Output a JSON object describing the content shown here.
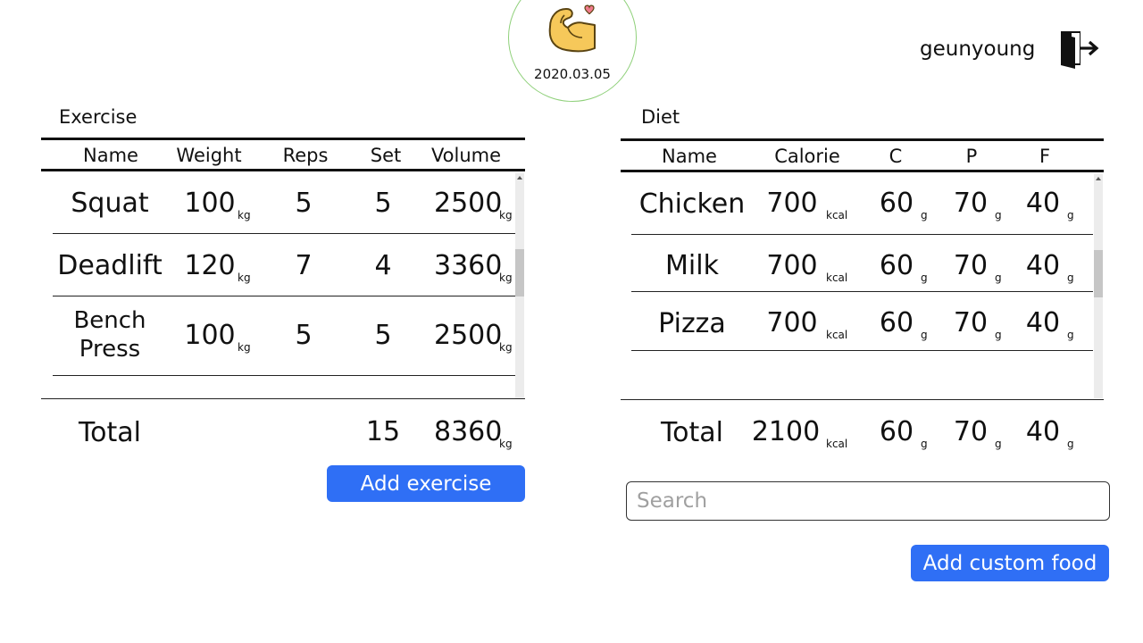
{
  "header": {
    "date": "2020.03.05",
    "username": "geunyoung",
    "logo_icon": "flexed-biceps-heart-icon",
    "logout_icon": "logout-door-icon"
  },
  "exercise": {
    "title": "Exercise",
    "columns": [
      "Name",
      "Weight",
      "Reps",
      "Set",
      "Volume"
    ],
    "rows": [
      {
        "name": "Squat",
        "weight": "100",
        "weight_unit": "kg",
        "reps": "5",
        "set": "5",
        "volume": "2500",
        "volume_unit": "kg"
      },
      {
        "name": "Deadlift",
        "weight": "120",
        "weight_unit": "kg",
        "reps": "7",
        "set": "4",
        "volume": "3360",
        "volume_unit": "kg"
      },
      {
        "name_line1": "Bench",
        "name_line2": "Press",
        "weight": "100",
        "weight_unit": "kg",
        "reps": "5",
        "set": "5",
        "volume": "2500",
        "volume_unit": "kg"
      }
    ],
    "total": {
      "label": "Total",
      "set": "15",
      "volume": "8360",
      "volume_unit": "kg"
    },
    "add_button": "Add exercise"
  },
  "diet": {
    "title": "Diet",
    "columns": [
      "Name",
      "Calorie",
      "C",
      "P",
      "F"
    ],
    "rows": [
      {
        "name": "Chicken",
        "calorie": "700",
        "calorie_unit": "kcal",
        "c": "60",
        "p": "70",
        "f": "40",
        "g": "g"
      },
      {
        "name": "Milk",
        "calorie": "700",
        "calorie_unit": "kcal",
        "c": "60",
        "p": "70",
        "f": "40",
        "g": "g"
      },
      {
        "name": "Pizza",
        "calorie": "700",
        "calorie_unit": "kcal",
        "c": "60",
        "p": "70",
        "f": "40",
        "g": "g"
      }
    ],
    "total": {
      "label": "Total",
      "calorie": "2100",
      "calorie_unit": "kcal",
      "c": "60",
      "p": "70",
      "f": "40",
      "g": "g"
    },
    "search_placeholder": "Search",
    "search_value": "",
    "add_button": "Add custom food"
  },
  "colors": {
    "accent": "#2f6ff5",
    "logo_ring": "#8fd07a"
  }
}
